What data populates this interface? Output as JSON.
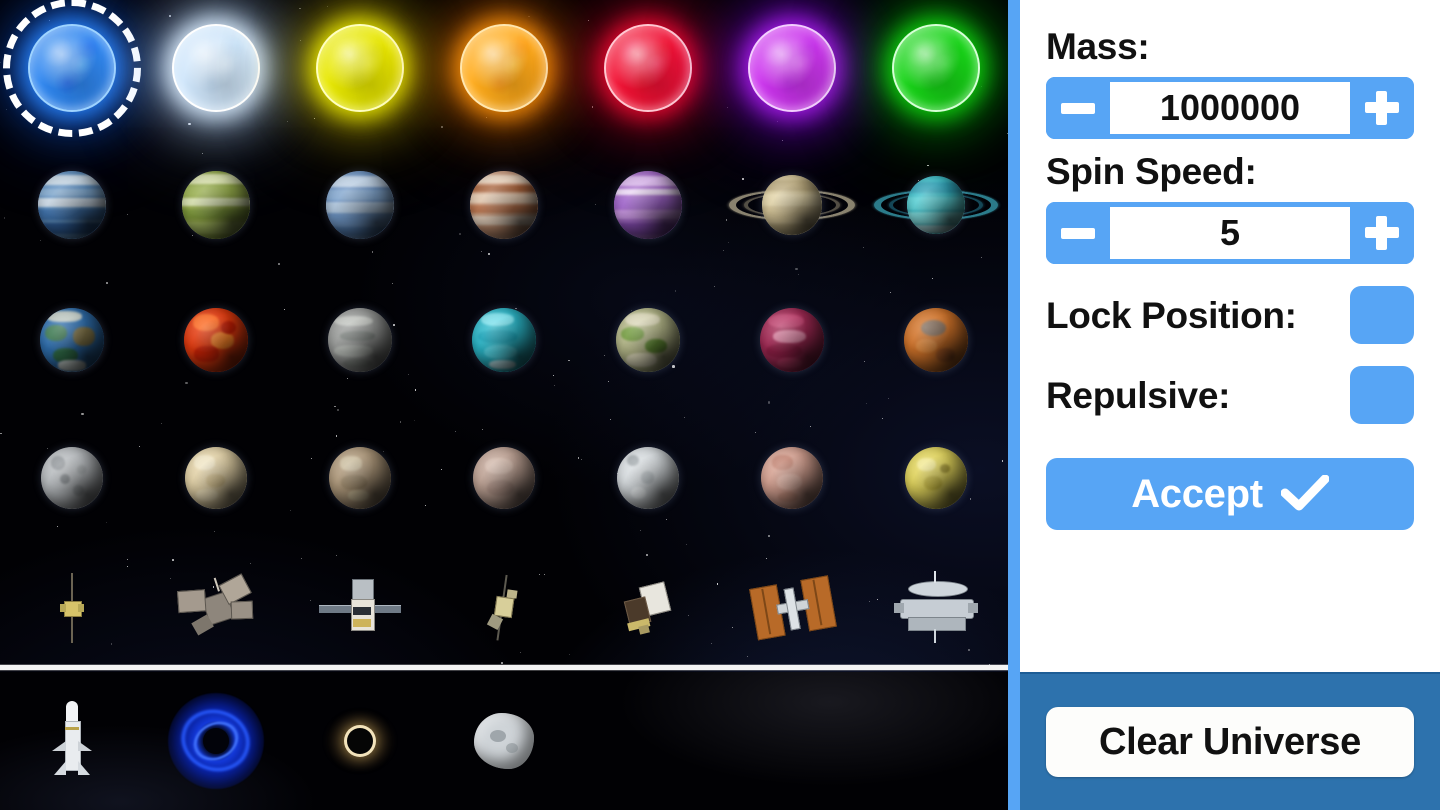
{
  "panel": {
    "mass": {
      "label": "Mass:",
      "value": "1000000",
      "decrement_icon": "minus-icon",
      "increment_icon": "plus-icon"
    },
    "spin_speed": {
      "label": "Spin Speed:",
      "value": "5",
      "decrement_icon": "minus-icon",
      "increment_icon": "plus-icon"
    },
    "lock_position": {
      "label": "Lock Position:",
      "checked": false
    },
    "repulsive": {
      "label": "Repulsive:",
      "checked": false
    },
    "accept": {
      "label": "Accept",
      "icon": "checkmark-icon"
    },
    "clear_universe": {
      "label": "Clear Universe"
    },
    "colors": {
      "accent_blue": "#57a5f5",
      "panel_bottom_blue": "#2d72ad",
      "panel_bg": "#ffffff",
      "text_dark": "#111111",
      "rail_blue": "#57a5f5"
    }
  },
  "picker": {
    "selected_index": 0,
    "selection_indicator": "dashed-white-ring",
    "rows": [
      {
        "name": "stars",
        "items": [
          {
            "name": "blue-star",
            "color": "#2e86f0",
            "glow": "#1f7ae8",
            "selected": true
          },
          {
            "name": "white-star",
            "color": "#cfe6fb",
            "glow": "#ffffff",
            "selected": false
          },
          {
            "name": "yellow-star",
            "color": "#e8e800",
            "glow": "#ffe800",
            "selected": false
          },
          {
            "name": "orange-star",
            "color": "#ffab1a",
            "glow": "#ff9000",
            "selected": false
          },
          {
            "name": "red-star",
            "color": "#f21133",
            "glow": "#e80026",
            "selected": false
          },
          {
            "name": "magenta-star",
            "color": "#cc33ee",
            "glow": "#9b1ce8",
            "selected": false
          },
          {
            "name": "green-star",
            "color": "#17d417",
            "glow": "#00d400",
            "selected": false
          }
        ]
      },
      {
        "name": "gas-giants",
        "items": [
          {
            "name": "blue-banded-gas-giant",
            "color": "#5e8fc0"
          },
          {
            "name": "green-banded-gas-giant",
            "color": "#93a94a"
          },
          {
            "name": "pale-blue-gas-giant",
            "color": "#6f95c4"
          },
          {
            "name": "jupiter-gas-giant",
            "color": "#cfa184"
          },
          {
            "name": "purple-banded-gas-giant",
            "color": "#a66ccb"
          },
          {
            "name": "saturn-ringed-planet",
            "color": "#d7c79a"
          },
          {
            "name": "uranus-ringed-planet",
            "color": "#3fc1cc"
          }
        ]
      },
      {
        "name": "terrestrial-planets",
        "items": [
          {
            "name": "earth-planet",
            "color": "#2f6fae"
          },
          {
            "name": "lava-planet",
            "color": "#e33a0e"
          },
          {
            "name": "grey-rocky-planet",
            "color": "#9a9c9a"
          },
          {
            "name": "ocean-ice-planet",
            "color": "#2bb7c9"
          },
          {
            "name": "forest-planet",
            "color": "#b6b98a"
          },
          {
            "name": "crimson-planet",
            "color": "#a32a55"
          },
          {
            "name": "mars-planet",
            "color": "#d2742a"
          }
        ]
      },
      {
        "name": "moons-and-dwarfs",
        "items": [
          {
            "name": "grey-cratered-moon",
            "color": "#b9bdc0"
          },
          {
            "name": "cream-moon",
            "color": "#e4d3a8"
          },
          {
            "name": "tan-moon",
            "color": "#b09a7c"
          },
          {
            "name": "dusty-pink-moon",
            "color": "#c0a496"
          },
          {
            "name": "icy-white-moon",
            "color": "#d8dde0"
          },
          {
            "name": "salmon-moon",
            "color": "#d6a292"
          },
          {
            "name": "io-yellow-moon",
            "color": "#e2d55c"
          }
        ]
      },
      {
        "name": "spacecraft",
        "items": [
          {
            "name": "antenna-satellite",
            "color": "#d6c36a"
          },
          {
            "name": "probe-spacecraft",
            "color": "#bdb3a6"
          },
          {
            "name": "solar-panel-satellite",
            "color": "#e8e4da"
          },
          {
            "name": "small-observatory-satellite",
            "color": "#d8cf9a"
          },
          {
            "name": "telescope-satellite",
            "color": "#ddd6c6"
          },
          {
            "name": "space-station-iss",
            "color": "#c2712c"
          },
          {
            "name": "large-orbital-station",
            "color": "#dfe4ea"
          }
        ]
      }
    ],
    "special_row": {
      "name": "special-objects",
      "items": [
        {
          "name": "rocket",
          "color": "#eceff2"
        },
        {
          "name": "blue-wormhole",
          "color": "#1a4fe0"
        },
        {
          "name": "black-hole",
          "color": "#c8a048"
        },
        {
          "name": "asteroid",
          "color": "#d3d7da"
        }
      ]
    }
  }
}
